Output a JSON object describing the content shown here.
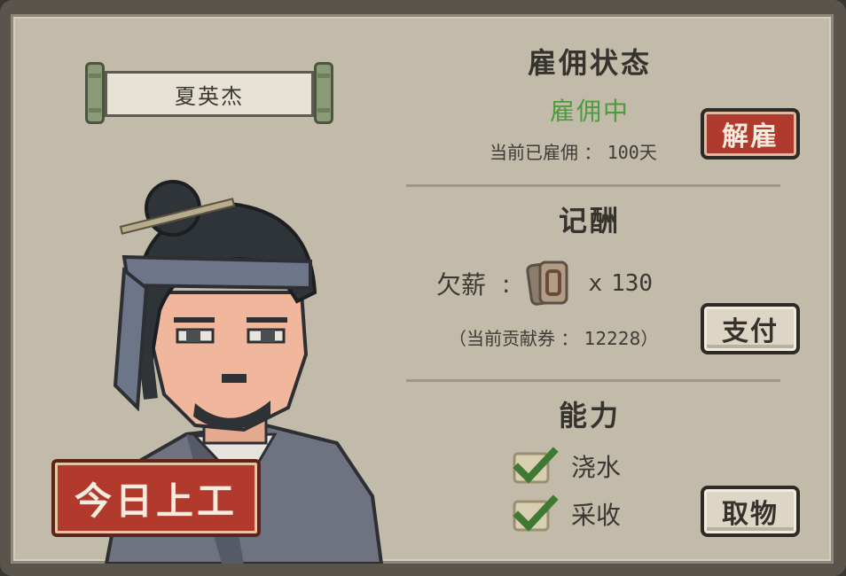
{
  "character": {
    "name": "夏英杰"
  },
  "stamp": {
    "label": "今日上工"
  },
  "employment": {
    "title": "雇佣状态",
    "status": "雇佣中",
    "days_label": "当前已雇佣",
    "days_value": "100天",
    "dismiss_button": "解雇"
  },
  "wages": {
    "title": "记酬",
    "owed_label": "欠薪",
    "owed_prefix": "x",
    "owed_amount": "130",
    "voucher_text": "（当前贡献券 ： 12228）",
    "pay_button": "支付"
  },
  "abilities": {
    "title": "能力",
    "items": [
      {
        "label": "浇水",
        "checked": true
      },
      {
        "label": "采收",
        "checked": true
      }
    ],
    "take_button": "取物"
  },
  "colors": {
    "status_green": "#4e9a3e",
    "button_red": "#b03a2d",
    "stamp_red": "#b23a2c",
    "panel": "#c2bbaa"
  }
}
